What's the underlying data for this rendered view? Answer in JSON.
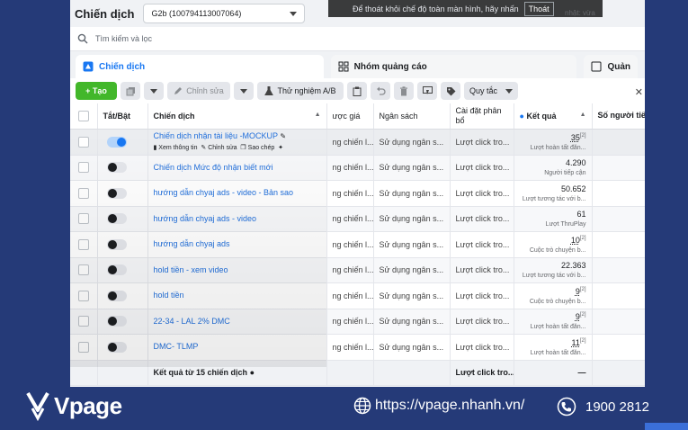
{
  "app_title": "Chiến dịch",
  "account": "G2b (100794113007064)",
  "toast": {
    "text": "Để thoát khỏi chế độ toàn màn hình, hãy nhấn",
    "button": "Thoát"
  },
  "updated": "nhật: vừa",
  "search": {
    "placeholder": "Tìm kiếm và lọc"
  },
  "tabs": [
    {
      "label": "Chiến dịch",
      "active": true
    },
    {
      "label": "Nhóm quảng cáo",
      "active": false
    },
    {
      "label": "Quản",
      "active": false
    }
  ],
  "toolbar": {
    "create": "+ Tạo",
    "edit": "Chỉnh sửa",
    "ab_test": "Thử nghiệm A/B",
    "rules": "Quy tắc"
  },
  "columns": {
    "toggle": "Tắt/Bật",
    "campaign": "Chiến dịch",
    "bid": "ược giá",
    "budget": "Ngân sách",
    "attribution": "Cài đặt phân bổ",
    "results": "Kết quả",
    "people": "Số người tiếp cận"
  },
  "row_actions": {
    "view": "Xem thông tin",
    "edit": "Chỉnh sửa",
    "copy": "Sao chép"
  },
  "rows": [
    {
      "name": "Chiến dịch nhận tài liệu -MOCKUP",
      "on": true,
      "bid": "ng chiến l...",
      "budget": "Sử dụng ngân s...",
      "attr": "Lượt click tro...",
      "result": "35",
      "sup": "[2]",
      "result_label": "Lượt hoàn tất đăn..."
    },
    {
      "name": "Chiến dịch Mức độ nhận biết mới",
      "on": false,
      "bid": "ng chiến l...",
      "budget": "Sử dụng ngân s...",
      "attr": "Lượt click tro...",
      "result": "4.290",
      "sup": "",
      "result_label": "Người tiếp cận"
    },
    {
      "name": "hướng dẫn chyaj ads - video - Bản sao",
      "on": false,
      "bid": "ng chiến l...",
      "budget": "Sử dụng ngân s...",
      "attr": "Lượt click tro...",
      "result": "50.652",
      "sup": "",
      "result_label": "Lượt tương tác với b..."
    },
    {
      "name": "hướng dẫn chyaj ads - video",
      "on": false,
      "bid": "ng chiến l...",
      "budget": "Sử dụng ngân s...",
      "attr": "Lượt click tro...",
      "result": "61",
      "sup": "",
      "result_label": "Lượt ThruPlay"
    },
    {
      "name": "hướng dẫn chyaj ads",
      "on": false,
      "bid": "ng chiến l...",
      "budget": "Sử dụng ngân s...",
      "attr": "Lượt click tro...",
      "result": "10",
      "sup": "[2]",
      "result_label": "Cuộc trò chuyện b..."
    },
    {
      "name": "hold tiền - xem video",
      "on": false,
      "bid": "ng chiến l...",
      "budget": "Sử dụng ngân s...",
      "attr": "Lượt click tro...",
      "result": "22.363",
      "sup": "",
      "result_label": "Lượt tương tác với b..."
    },
    {
      "name": "hold tiền",
      "on": false,
      "bid": "ng chiến l...",
      "budget": "Sử dụng ngân s...",
      "attr": "Lượt click tro...",
      "result": "9",
      "sup": "[2]",
      "result_label": "Cuộc trò chuyện b..."
    },
    {
      "name": "22-34 - LAL 2% DMC",
      "on": false,
      "bid": "ng chiến l...",
      "budget": "Sử dụng ngân s...",
      "attr": "Lượt click tro...",
      "result": "9",
      "sup": "[2]",
      "result_label": "Lượt hoàn tất đăn..."
    },
    {
      "name": "DMC- TLMP",
      "on": false,
      "bid": "ng chiến l...",
      "budget": "Sử dụng ngân s...",
      "attr": "Lượt click tro...",
      "result": "11",
      "sup": "[2]",
      "result_label": "Lượt hoàn tất đăn..."
    }
  ],
  "summary": {
    "label": "Kết quả từ 15 chiến dịch",
    "attr": "Lượt click tro...",
    "result": "—"
  },
  "footer": {
    "brand": "Vpage",
    "url": "https://vpage.nhanh.vn/",
    "phone": "1900 2812"
  },
  "colors": {
    "accent": "#1877f2",
    "create": "#42b72a",
    "footer": "#253a78"
  }
}
